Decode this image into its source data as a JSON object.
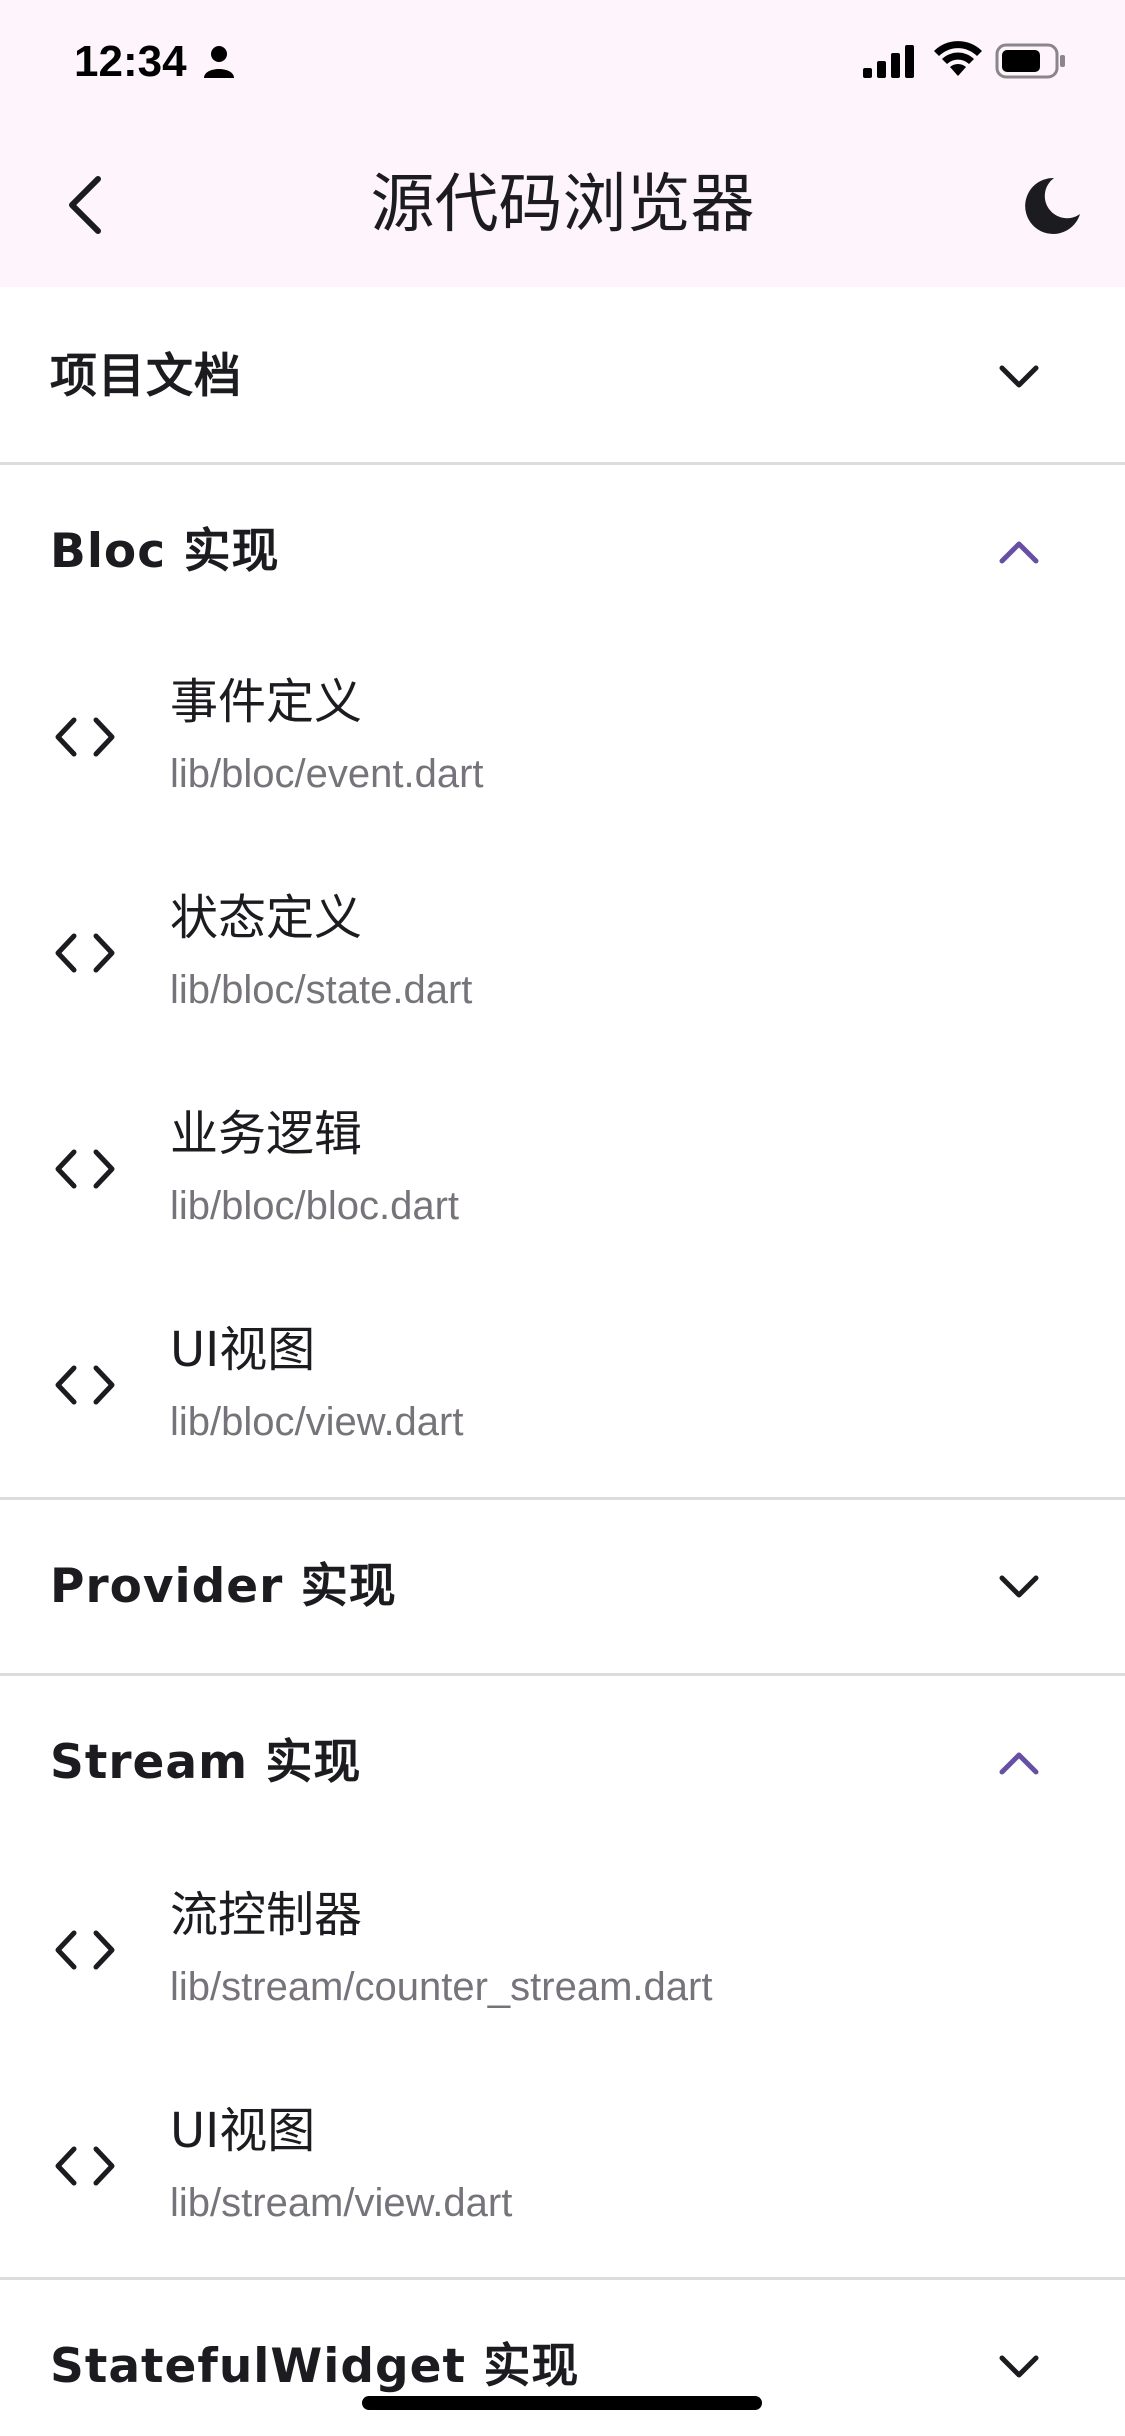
{
  "status_bar": {
    "time": "12:34"
  },
  "app_bar": {
    "title": "源代码浏览器",
    "back_icon": "chevron-left-icon",
    "theme_icon": "moon-icon"
  },
  "colors": {
    "appbar_bg": "#fdf5fb",
    "accent": "#6750a4",
    "path_text": "#76737a",
    "divider": "#dcdcdc"
  },
  "sections": [
    {
      "title": "项目文档",
      "expanded": false,
      "items": []
    },
    {
      "title": "Bloc 实现",
      "expanded": true,
      "items": [
        {
          "name": "事件定义",
          "path": "lib/bloc/event.dart"
        },
        {
          "name": "状态定义",
          "path": "lib/bloc/state.dart"
        },
        {
          "name": "业务逻辑",
          "path": "lib/bloc/bloc.dart"
        },
        {
          "name": "UI视图",
          "path": "lib/bloc/view.dart"
        }
      ]
    },
    {
      "title": "Provider 实现",
      "expanded": false,
      "items": []
    },
    {
      "title": "Stream 实现",
      "expanded": true,
      "items": [
        {
          "name": "流控制器",
          "path": "lib/stream/counter_stream.dart"
        },
        {
          "name": "UI视图",
          "path": "lib/stream/view.dart"
        }
      ]
    },
    {
      "title": "StatefulWidget 实现",
      "expanded": false,
      "items": []
    }
  ]
}
